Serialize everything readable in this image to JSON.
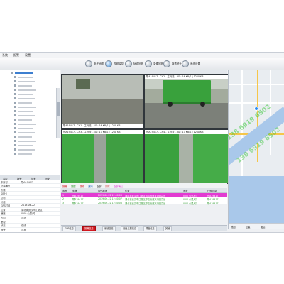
{
  "menu": [
    "系统",
    "报警",
    "设置"
  ],
  "toolbar": [
    {
      "label": "电子地图",
      "icon": "globe-icon"
    },
    {
      "label": "视频监控",
      "icon": "camera-icon"
    },
    {
      "label": "轨迹回放",
      "icon": "track-icon"
    },
    {
      "label": "录像回放",
      "icon": "playback-icon"
    },
    {
      "label": "报表统计",
      "icon": "report-icon"
    },
    {
      "label": "系统设置",
      "icon": "settings-icon"
    },
    {
      "label": "车辆管理",
      "icon": "vehicle-icon"
    }
  ],
  "left_tabs": [
    "监控",
    "报警",
    "搜索",
    "历史"
  ],
  "info_rows": [
    {
      "k": "车牌号",
      "v": "鄂A19417"
    },
    {
      "k": "终端编号",
      "v": ""
    },
    {
      "k": "所属",
      "v": ""
    },
    {
      "k": "SIM卡",
      "v": ""
    },
    {
      "k": "公司",
      "v": ""
    },
    {
      "k": "分组",
      "v": ""
    },
    {
      "k": "GPS时间",
      "v": "2019-06-22"
    },
    {
      "k": "位置",
      "v": "湖北省武汉市江夏区"
    },
    {
      "k": "速度",
      "v": "0.00 公里/时"
    },
    {
      "k": "方向",
      "v": "正北"
    },
    {
      "k": "里程",
      "v": ""
    },
    {
      "k": "状态",
      "v": "在线"
    },
    {
      "k": "报警",
      "v": "正常"
    }
  ],
  "video_tiles": [
    {
      "label": "鄂A19417 - CH1 - 主码流 - 4G : 16 KB/S | 1260 KB"
    },
    {
      "label": "鄂A19417 - CH2 - 主码流 - 4G : 16 KB/S | 1260 KB"
    },
    {
      "label": "鄂A19417 - CH3 - 主码流 - 4G : 17 KB/S | 1260 KB"
    },
    {
      "label": "鄂A19417 - CH4 - 主码流 - 4G : 17 KB/S | 1260 KB"
    }
  ],
  "event_toolbar": [
    "报警",
    "提醒",
    "视频",
    "通知",
    "全部",
    "清除",
    "全部确认"
  ],
  "event_headers": [
    "序号",
    "车牌",
    "GPS时间",
    "位置",
    "速度",
    "行驶记录"
  ],
  "event_rows": [
    {
      "no": "1",
      "plate": "鄂A19417",
      "time": "2019-06-22 12:30:06",
      "loc": "湖北省武汉市江夏区郑店街道京港澳高速",
      "speed": "0.00 公里/时",
      "rec": "鄂A19417"
    },
    {
      "no": "2",
      "plate": "鄂A19417",
      "time": "2019-06-22 12:30:07",
      "loc": "湖北省武汉市江夏区郑店街道京港澳高速",
      "speed": "0.00 公里/时",
      "rec": "鄂A19417"
    },
    {
      "no": "3",
      "plate": "鄂A19417",
      "time": "2019-06-22 12:30:08",
      "loc": "湖北省武汉市江夏区郑店街道京港澳高速",
      "speed": "0.00 公里/时",
      "rec": "鄂A19417"
    }
  ],
  "bottom_tabs": [
    "GPS信息",
    "报警信息",
    "系统信息",
    "设备上报信息",
    "调度信息",
    "其他"
  ],
  "map_buttons": [
    "地图",
    "卫星",
    "图层"
  ],
  "watermark": "138 6919 6502",
  "colors": {
    "accent": "#3d7fd0",
    "alarm_row": "#e23bd1",
    "active_tab": "#d2171e",
    "row_green": "#2e9a2e"
  }
}
